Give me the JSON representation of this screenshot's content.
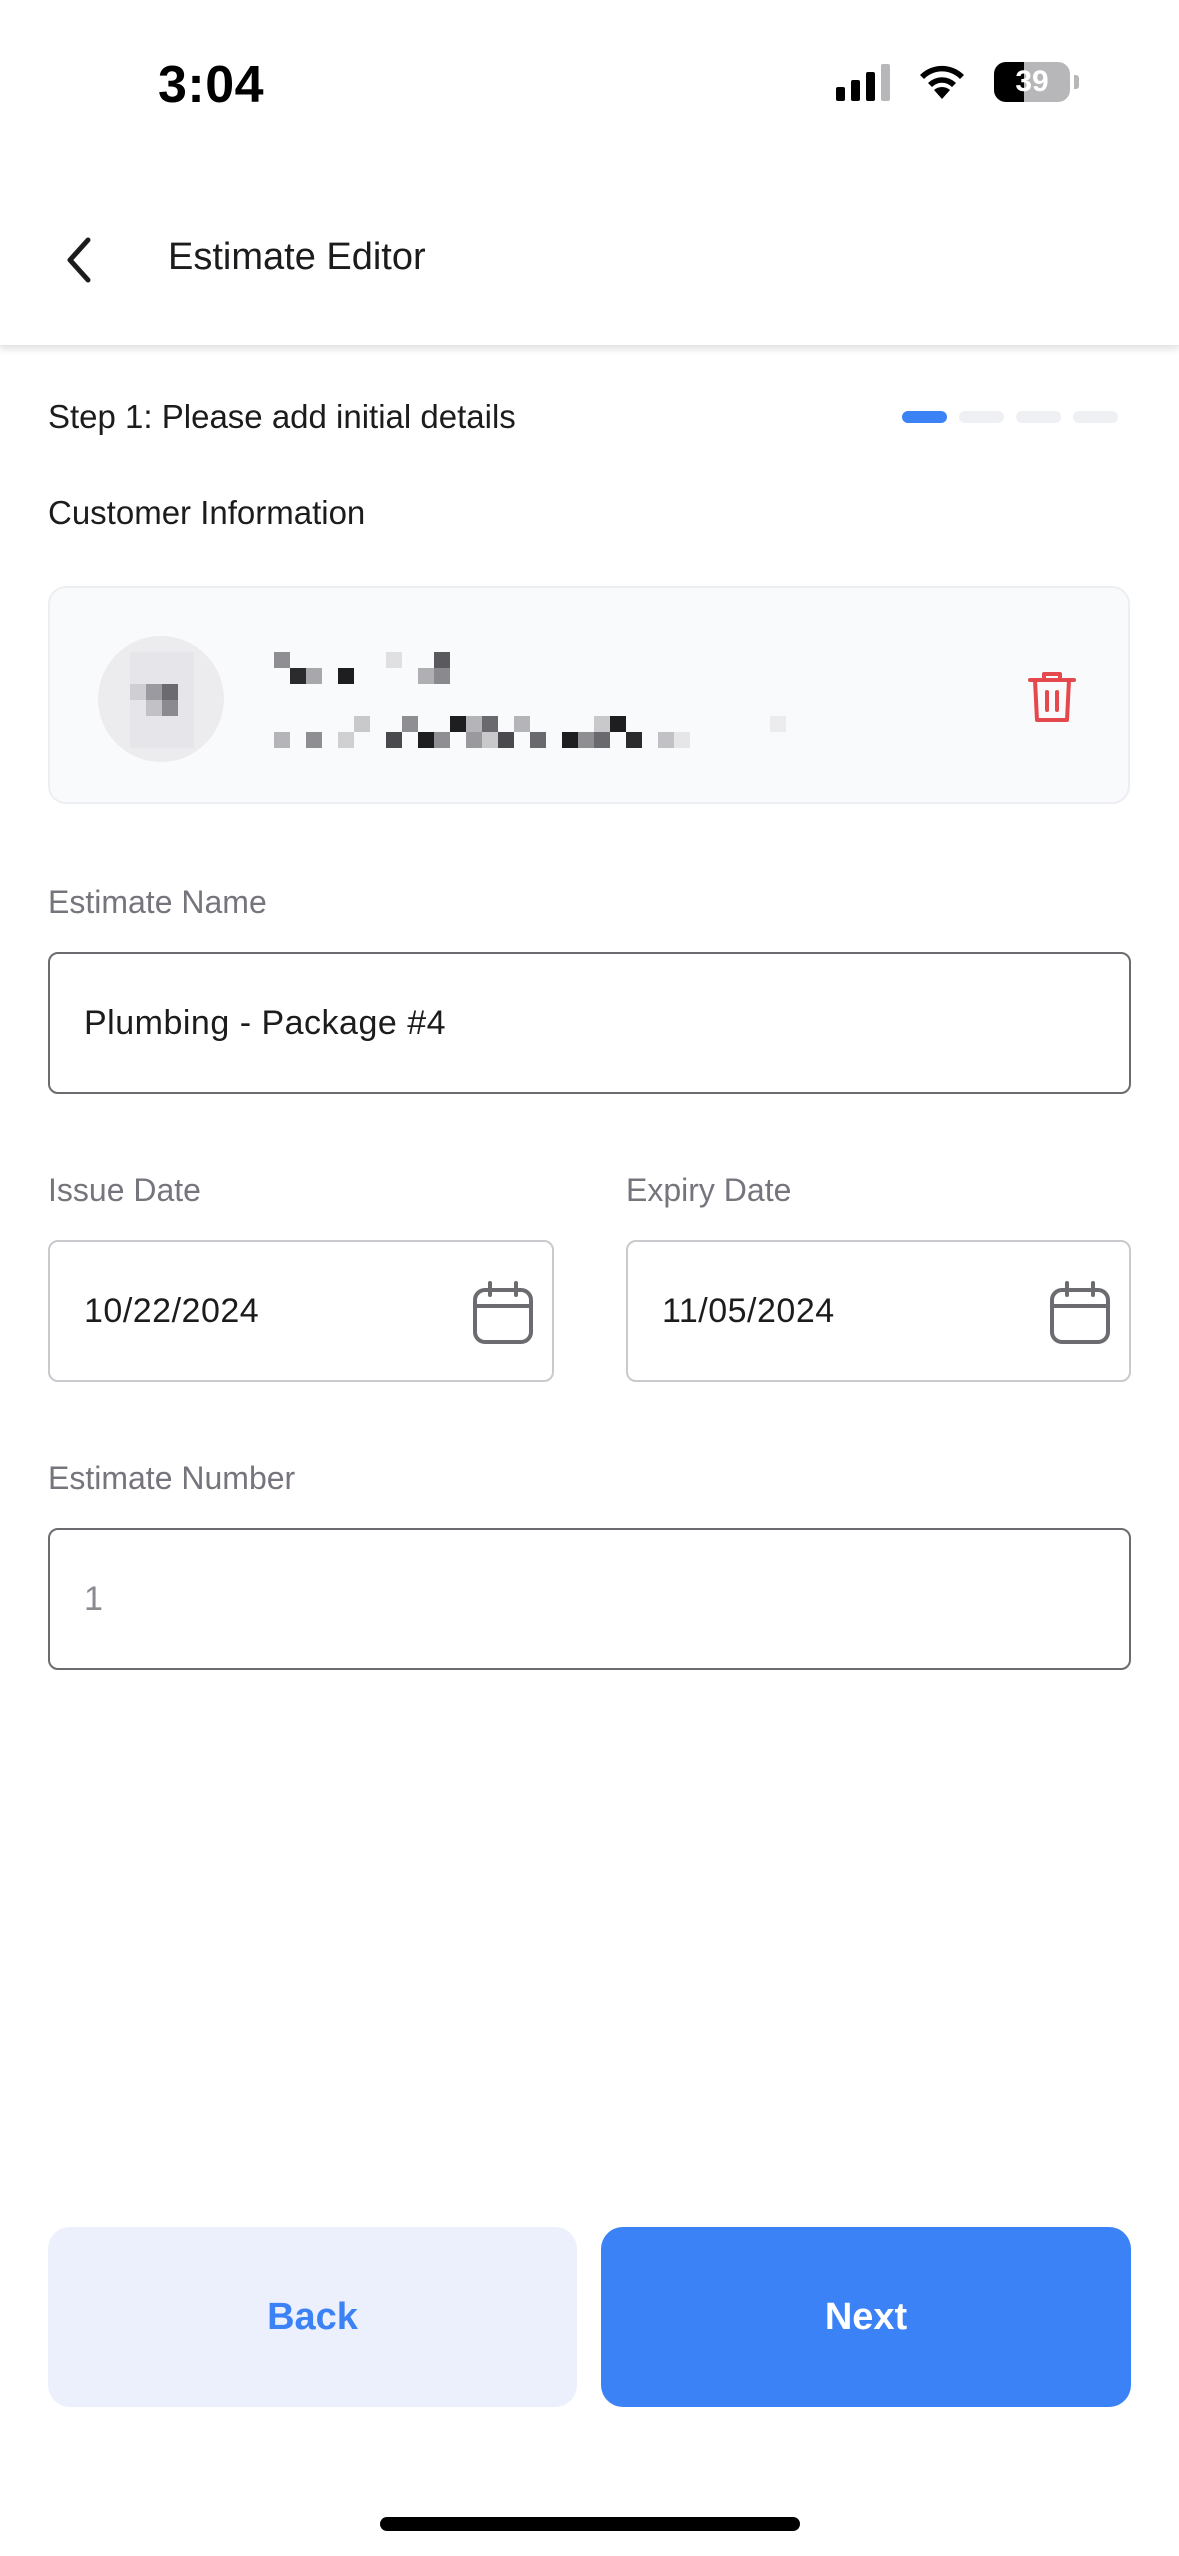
{
  "status_bar": {
    "time": "3:04",
    "battery_level": "39",
    "icons": [
      "cellular-signal-icon",
      "wifi-icon",
      "battery-icon"
    ]
  },
  "header": {
    "title": "Estimate Editor",
    "back_icon": "chevron-left-icon"
  },
  "step": {
    "text": "Step 1: Please add initial details",
    "current": 1,
    "total": 4
  },
  "customer": {
    "section_label": "Customer Information",
    "delete_icon": "trash-icon"
  },
  "form": {
    "estimate_name": {
      "label": "Estimate Name",
      "value": "Plumbing - Package #4"
    },
    "issue_date": {
      "label": "Issue Date",
      "value": "10/22/2024"
    },
    "expiry_date": {
      "label": "Expiry Date",
      "value": "11/05/2024"
    },
    "estimate_number": {
      "label": "Estimate Number",
      "placeholder": "1"
    }
  },
  "actions": {
    "back_label": "Back",
    "next_label": "Next"
  },
  "colors": {
    "accent": "#3b82f6",
    "accent_light": "#ecf0fd",
    "danger": "#e5484d",
    "label_gray": "#75757d"
  }
}
